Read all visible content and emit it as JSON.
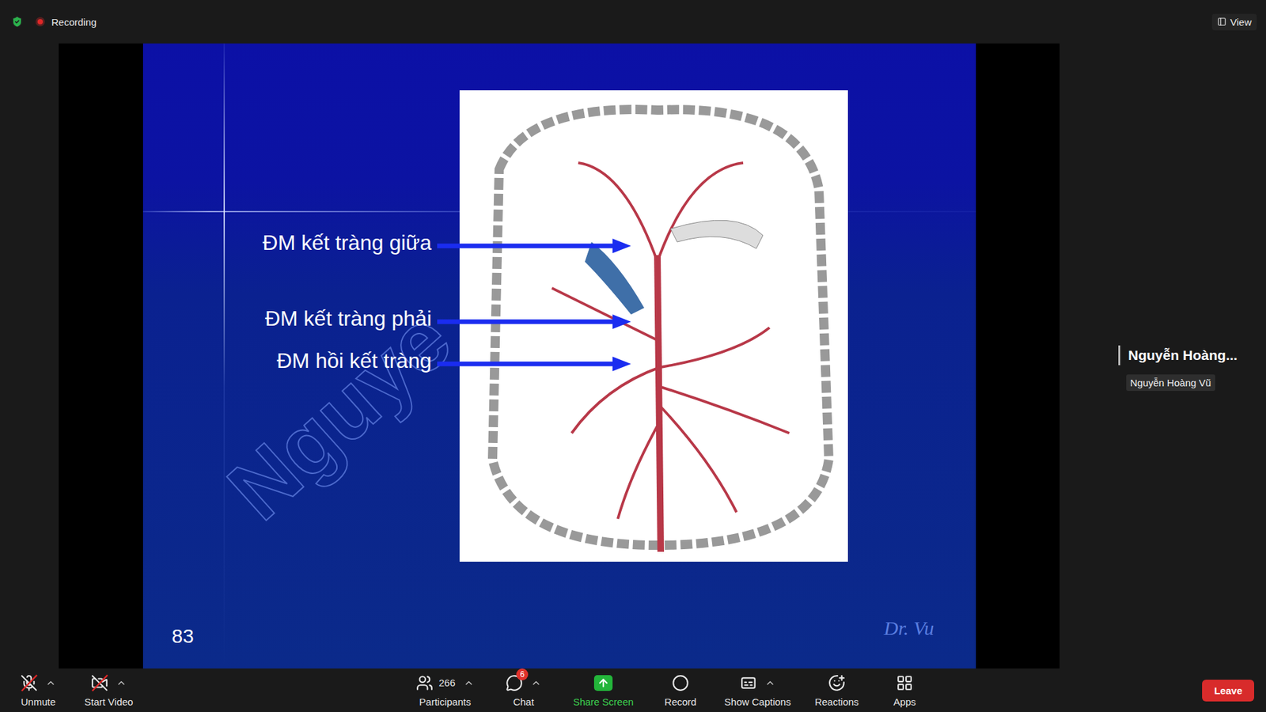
{
  "top_bar": {
    "recording": "Recording",
    "view": "View"
  },
  "slide": {
    "labels": [
      "ĐM kết tràng giữa",
      "ĐM kết tràng phải",
      "ĐM hồi kết tràng"
    ],
    "number": "83",
    "signature": "Dr. Vu",
    "watermark": "Nguye"
  },
  "participant": {
    "name": "Nguyễn Hoàng...",
    "tooltip": "Nguyễn Hoàng Vũ"
  },
  "toolbar": {
    "left": [
      {
        "label": "Unmute",
        "kind": "mic",
        "off": true,
        "caret": true
      },
      {
        "label": "Start Video",
        "kind": "video",
        "off": true,
        "caret": true
      }
    ],
    "center": [
      {
        "label": "Participants",
        "kind": "participants",
        "count": "266",
        "caret": true
      },
      {
        "label": "Chat",
        "kind": "chat",
        "badge": "6",
        "caret": true
      },
      {
        "label": "Share Screen",
        "kind": "share",
        "caret": false
      },
      {
        "label": "Record",
        "kind": "record",
        "caret": false
      },
      {
        "label": "Show Captions",
        "kind": "captions",
        "caret": true
      },
      {
        "label": "Reactions",
        "kind": "reactions",
        "caret": false
      },
      {
        "label": "Apps",
        "kind": "apps",
        "caret": false
      }
    ],
    "leave": "Leave"
  }
}
